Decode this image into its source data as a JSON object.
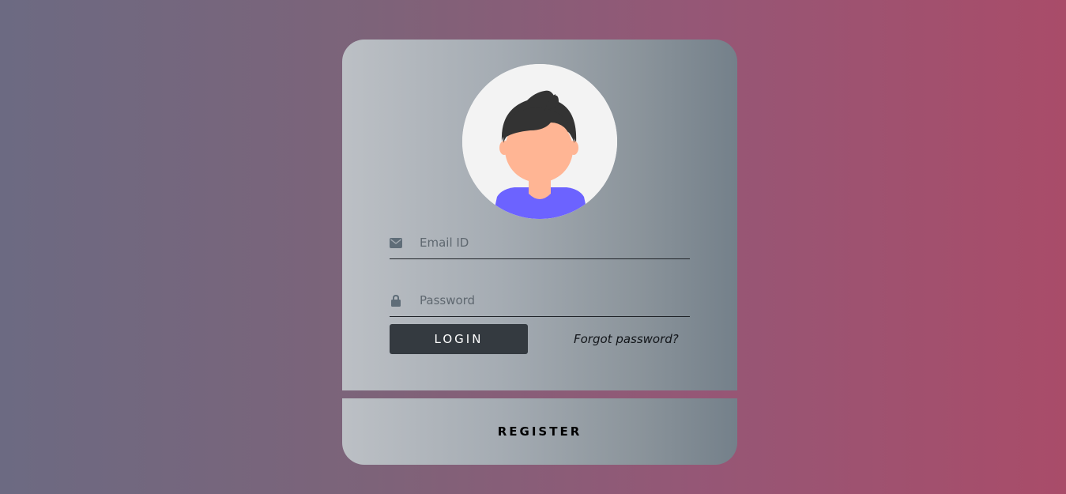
{
  "login_form": {
    "email": {
      "placeholder": "Email ID",
      "value": "",
      "icon": "envelope-icon"
    },
    "password": {
      "placeholder": "Password",
      "value": "",
      "icon": "lock-icon"
    },
    "login_label": "LOGIN",
    "forgot_label": "Forgot password?"
  },
  "register": {
    "label": "REGISTER"
  },
  "avatar": {
    "icon": "user-avatar-icon"
  },
  "colors": {
    "button_bg": "#343a40",
    "avatar_shirt": "#6c63ff",
    "avatar_skin": "#ffb594",
    "avatar_hair": "#333333",
    "icon_color": "#5f6d78"
  }
}
